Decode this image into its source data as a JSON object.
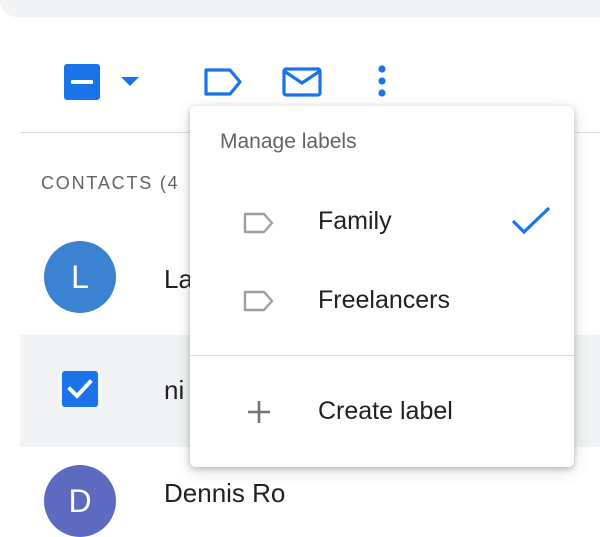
{
  "colors": {
    "accent": "#1a73e8",
    "avatar_1": "#3b82d0",
    "avatar_3": "#5c6bc0"
  },
  "toolbar": {
    "select_checkbox": "indeterminate",
    "icons": [
      "select-dropdown-icon",
      "label-icon",
      "mail-icon",
      "more-vert-icon"
    ]
  },
  "contacts": {
    "header": "CONTACTS (4",
    "rows": [
      {
        "avatar_letter": "L",
        "name": "La"
      },
      {
        "selected": true,
        "name": "ni"
      },
      {
        "avatar_letter": "D",
        "name": "Dennis Ro"
      }
    ]
  },
  "label_menu": {
    "title": "Manage labels",
    "items": [
      {
        "label": "Family",
        "icon": "label-outline-icon",
        "checked": true
      },
      {
        "label": "Freelancers",
        "icon": "label-outline-icon",
        "checked": false
      }
    ],
    "create": {
      "label": "Create label",
      "icon": "plus-icon"
    }
  }
}
